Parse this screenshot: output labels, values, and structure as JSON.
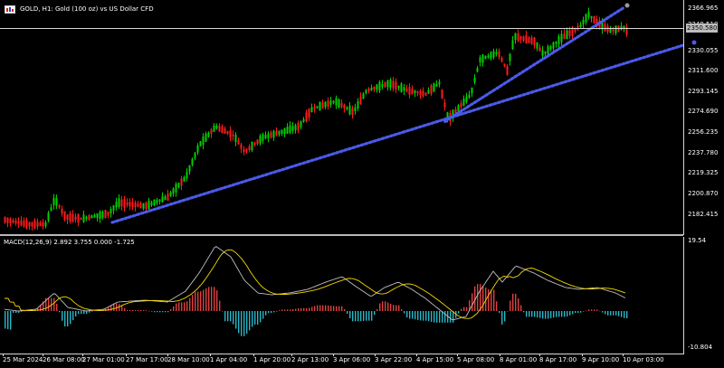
{
  "window": {
    "title": "GOLD, H1:  Gold (100 oz) vs US Dollar CFD",
    "icon": "chart-window-icon"
  },
  "price_axis": {
    "labels": [
      "2366.965",
      "2348.510",
      "2330.055",
      "2311.600",
      "2293.145",
      "2274.690",
      "2256.235",
      "2237.780",
      "2219.325",
      "2200.870",
      "2182.415"
    ],
    "current_price": "2350.580"
  },
  "macd": {
    "title": "MACD(12,26,9) 2.892 3.755 0.000 -1.725",
    "axis_labels": [
      "19.54",
      "-10.804"
    ]
  },
  "time_axis": {
    "labels": [
      "25 Mar 2024",
      "26 Mar 08:00",
      "27 Mar 01:00",
      "27 Mar 17:00",
      "28 Mar 10:00",
      "1 Apr 04:00",
      "1 Apr 20:00",
      "2 Apr 13:00",
      "3 Apr 06:00",
      "3 Apr 22:00",
      "4 Apr 15:00",
      "5 Apr 08:00",
      "8 Apr 01:00",
      "8 Apr 17:00",
      "9 Apr 10:00",
      "10 Apr 03:00"
    ]
  },
  "colors": {
    "background": "#000000",
    "bull_candle": "#00d000",
    "bear_candle": "#ff1a1a",
    "trendline": "#4a5ae8",
    "macd_line": "#c0c0c0",
    "signal_line": "#f5d800",
    "hist_positive": "#e04040",
    "hist_negative": "#28b6c8"
  }
}
